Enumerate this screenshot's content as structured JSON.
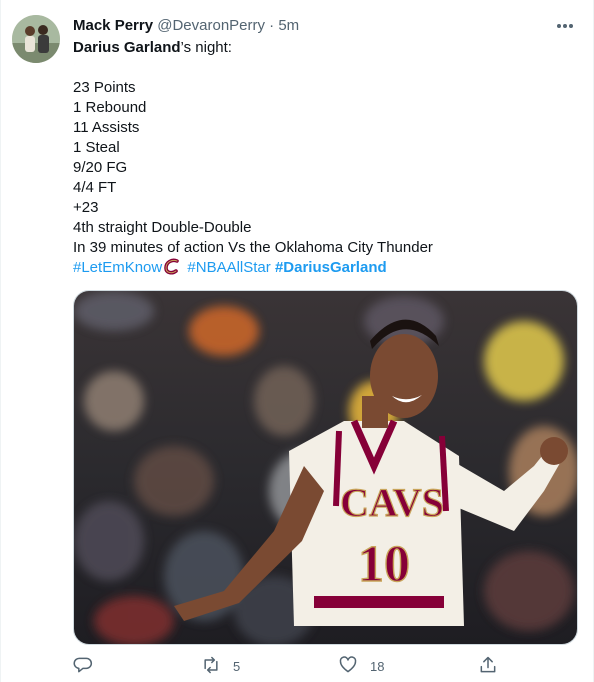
{
  "tweet": {
    "author_name": "Mack Perry",
    "handle": "@DevaronPerry",
    "separator": "·",
    "time": "5m",
    "intro_name": "Darius Garland",
    "intro_suffix": "’s night:",
    "stats": [
      "23 Points",
      "1 Rebound",
      "11 Assists",
      "1 Steal",
      "9/20 FG",
      "4/4 FT",
      "+23",
      "4th straight Double-Double",
      "In 39 minutes of action Vs the Oklahoma City Thunder"
    ],
    "hashtags": {
      "first": "#LetEmKnow",
      "second": "#NBAAllStar",
      "third": "#DariusGarland"
    },
    "jersey": {
      "team": "CAVS",
      "number": "10"
    }
  },
  "actions": {
    "retweet_count": "5",
    "like_count": "18"
  },
  "colors": {
    "link": "#1d9bf0",
    "secondary_text": "#536471",
    "jersey_wine": "#860038",
    "jersey_gold": "#c8a45a"
  },
  "icons": [
    "more-icon",
    "reply-icon",
    "retweet-icon",
    "like-icon",
    "share-icon",
    "cavs-c-emoji-icon"
  ]
}
